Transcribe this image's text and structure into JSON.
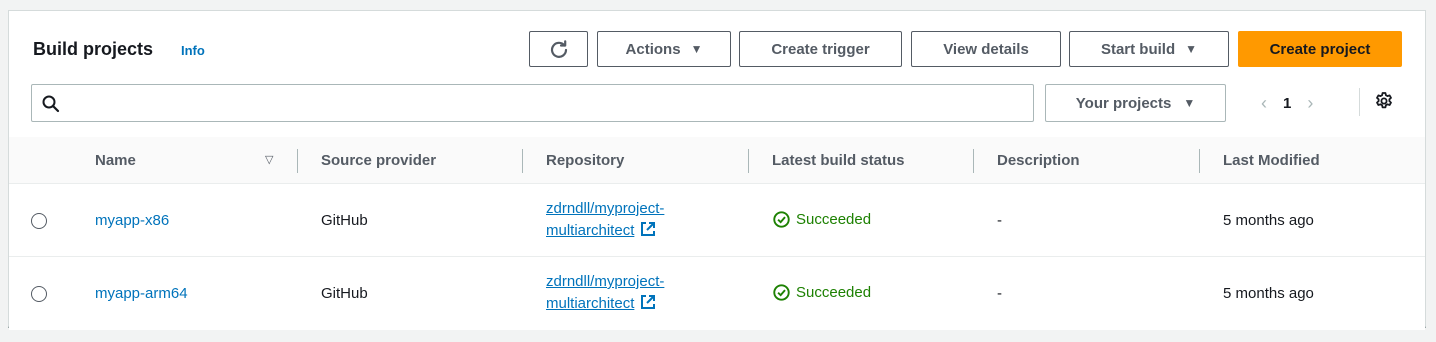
{
  "header": {
    "title": "Build projects",
    "info": "Info"
  },
  "toolbar": {
    "refresh_icon": "refresh-icon",
    "actions_label": "Actions",
    "create_trigger_label": "Create trigger",
    "view_details_label": "View details",
    "start_build_label": "Start build",
    "create_project_label": "Create project",
    "primary_color": "#ff9900"
  },
  "search": {
    "placeholder": "",
    "value": ""
  },
  "filter": {
    "scope_label": "Your projects"
  },
  "pagination": {
    "current_page": "1"
  },
  "table": {
    "columns": [
      "Name",
      "Source provider",
      "Repository",
      "Latest build status",
      "Description",
      "Last Modified"
    ],
    "rows": [
      {
        "name": "myapp-x86",
        "source_provider": "GitHub",
        "repository_line1": "zdrndll/myproject-",
        "repository_line2": "multiarchitect",
        "status": "Succeeded",
        "description": "-",
        "last_modified": "5 months ago"
      },
      {
        "name": "myapp-arm64",
        "source_provider": "GitHub",
        "repository_line1": "zdrndll/myproject-",
        "repository_line2": "multiarchitect",
        "status": "Succeeded",
        "description": "-",
        "last_modified": "5 months ago"
      }
    ]
  },
  "colors": {
    "link": "#0073bb",
    "success": "#1d8102"
  }
}
